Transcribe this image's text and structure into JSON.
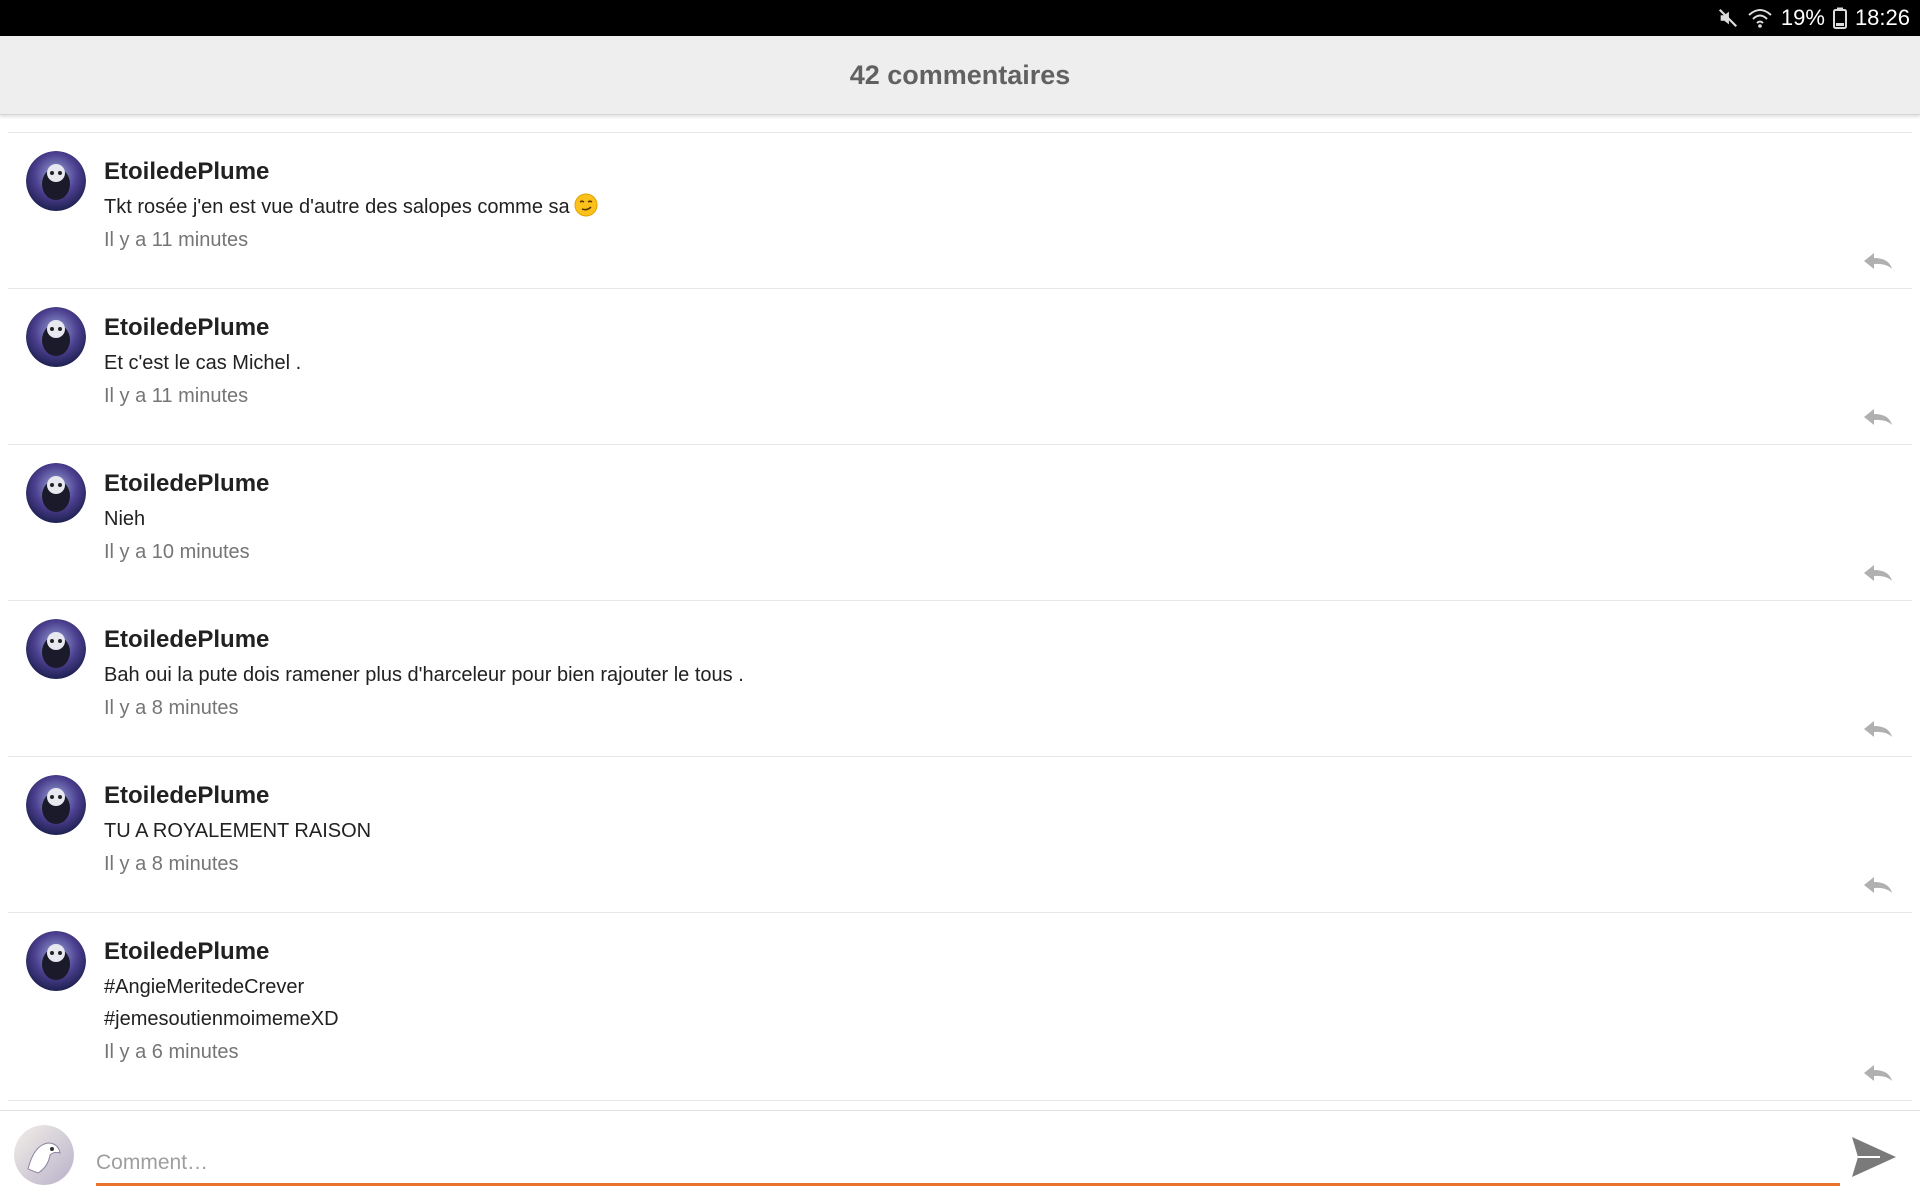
{
  "status_bar": {
    "battery": "19%",
    "time": "18:26",
    "icons": [
      "mute-icon",
      "wifi-icon",
      "battery-icon"
    ]
  },
  "header": {
    "title": "42 commentaires"
  },
  "comments": [
    {
      "author": "EtoiledePlume",
      "text": "Tkt rosée j'en est vue d'autre des salopes comme sa",
      "emoji": "smirk-emoji",
      "time": "Il y a 11 minutes"
    },
    {
      "author": "EtoiledePlume",
      "text": "Et c'est le cas Michel .",
      "time": "Il y a 11 minutes"
    },
    {
      "author": "EtoiledePlume",
      "text": "Nieh",
      "time": "Il y a 10 minutes"
    },
    {
      "author": "EtoiledePlume",
      "text": "Bah oui la pute dois ramener plus d'harceleur pour bien rajouter le tous .",
      "time": "Il y a 8 minutes"
    },
    {
      "author": "EtoiledePlume",
      "text": "TU A ROYALEMENT RAISON",
      "time": "Il y a 8 minutes"
    },
    {
      "author": "EtoiledePlume",
      "text": "#AngieMeritedeCrever\n#jemesoutienmoimemeXD",
      "time": "Il y a 6 minutes"
    }
  ],
  "composer": {
    "placeholder": "Comment…",
    "value": ""
  },
  "colors": {
    "accent": "#e8722a",
    "header_bg": "#eeeeee",
    "status_bar_bg": "#000000"
  }
}
